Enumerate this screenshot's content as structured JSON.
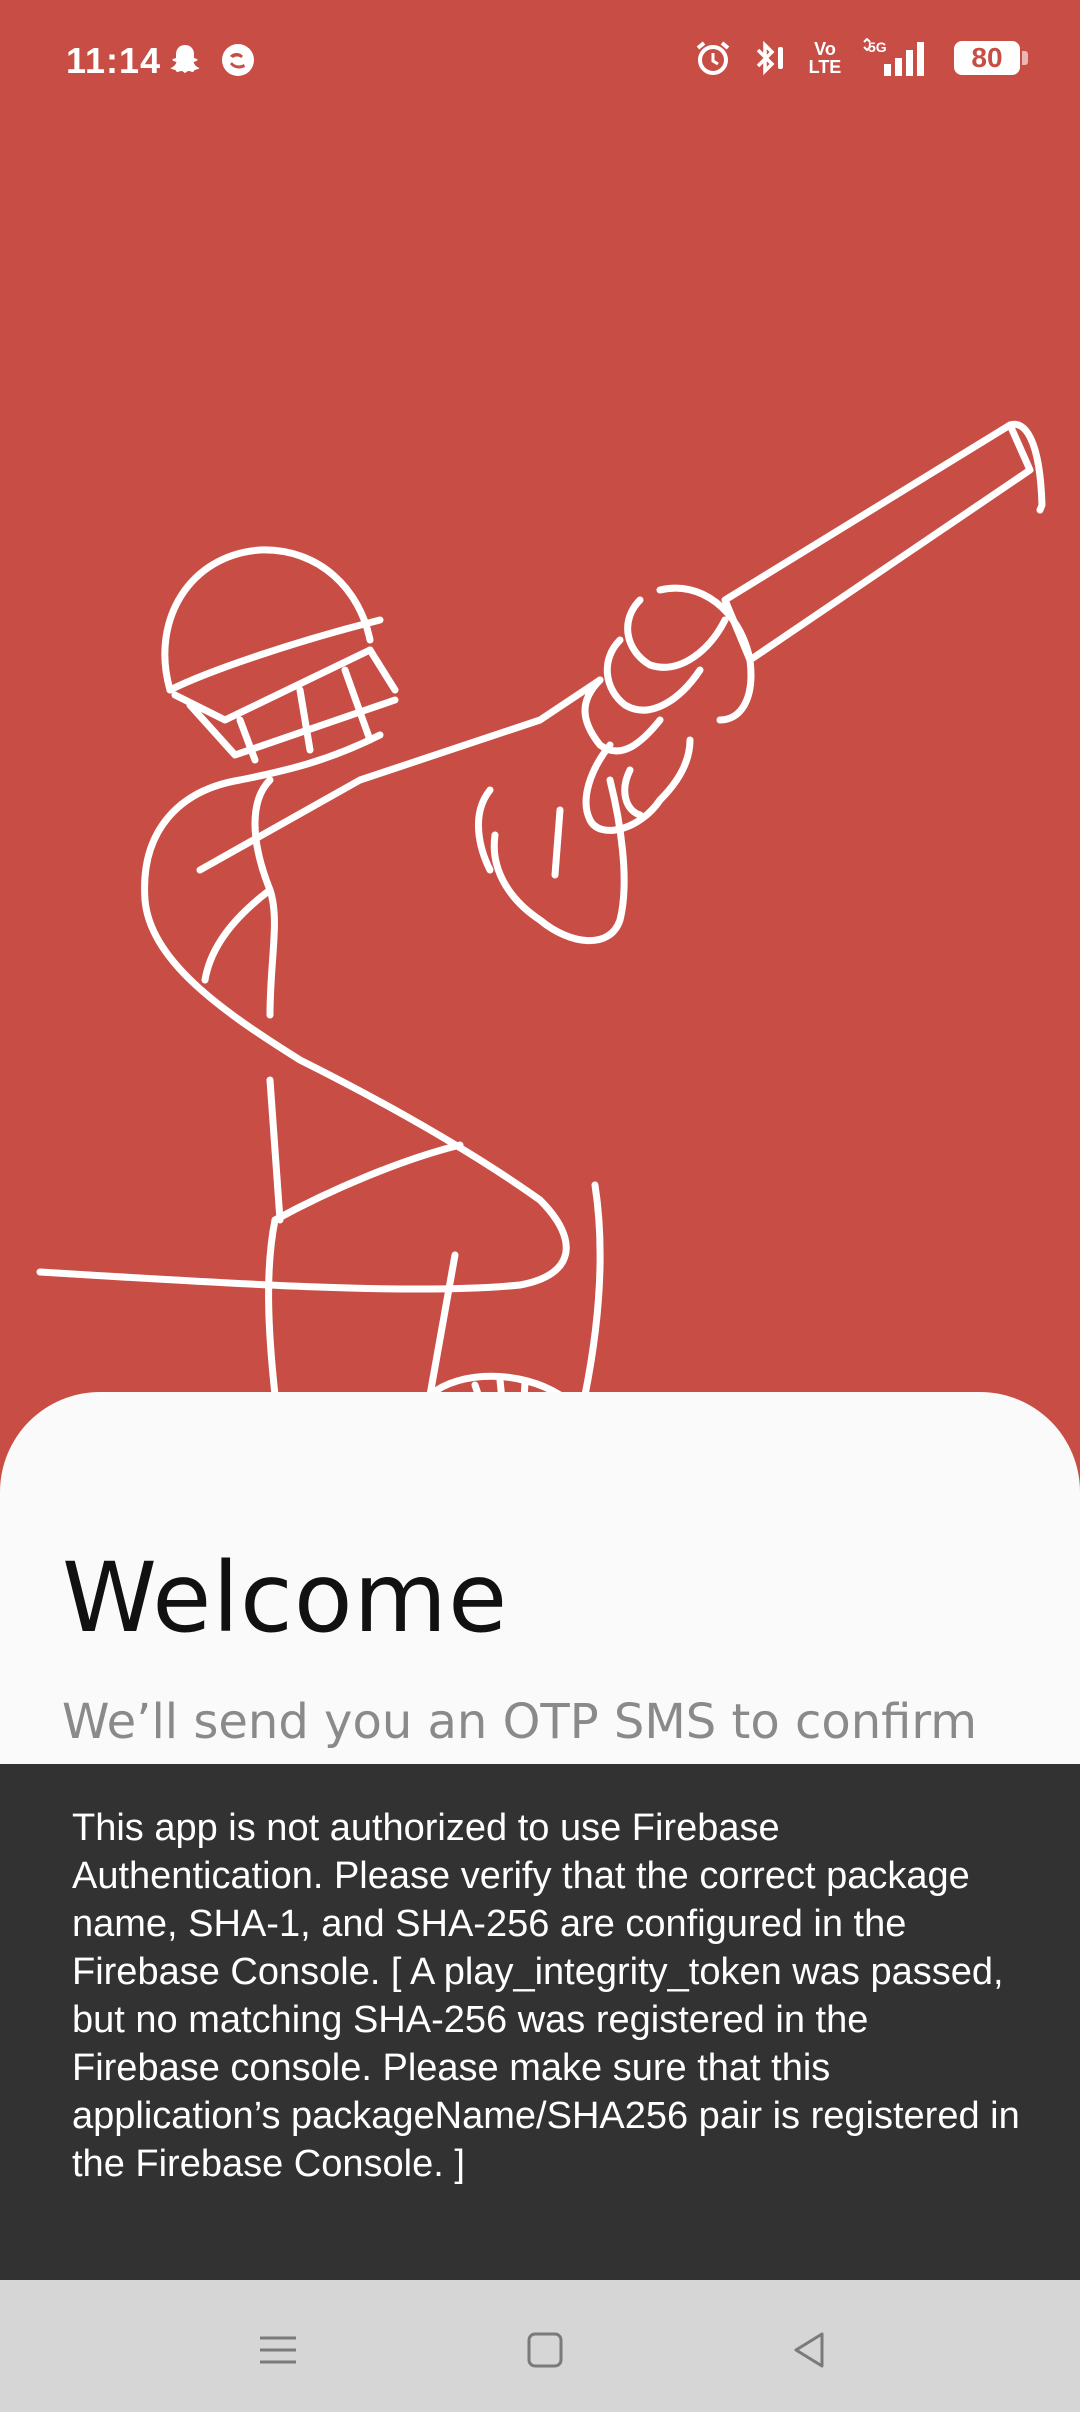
{
  "status_bar": {
    "time": "11:14",
    "left_icons": [
      "snapchat-icon",
      "messaging-icon"
    ],
    "volte_label_top": "Vo",
    "volte_label_bottom": "LTE",
    "network_label": "5G",
    "battery_level": "80"
  },
  "illustration": {
    "subject": "cricket-batsman-line-art",
    "stroke_color": "#FFFFFF"
  },
  "welcome": {
    "title": "Welcome",
    "subtitle": "We’ll send you an OTP SMS to confirm"
  },
  "snackbar": {
    "message": "This app is not authorized to use Firebase Authentication. Please verify that the correct package name, SHA-1, and SHA-256 are configured in the Firebase Console. [ A play_integrity_token was passed, but no matching SHA-256 was registered in the Firebase console. Please make sure that this application’s packageName/SHA256 pair is registered in the Firebase Console. ]"
  },
  "nav_bar": {
    "buttons": [
      "menu-icon",
      "home-icon",
      "back-icon"
    ]
  },
  "colors": {
    "background": "#C84E45",
    "sheet": "#FAFAFA",
    "snackbar": "#323232",
    "nav_bar": "#D6D6D6"
  }
}
